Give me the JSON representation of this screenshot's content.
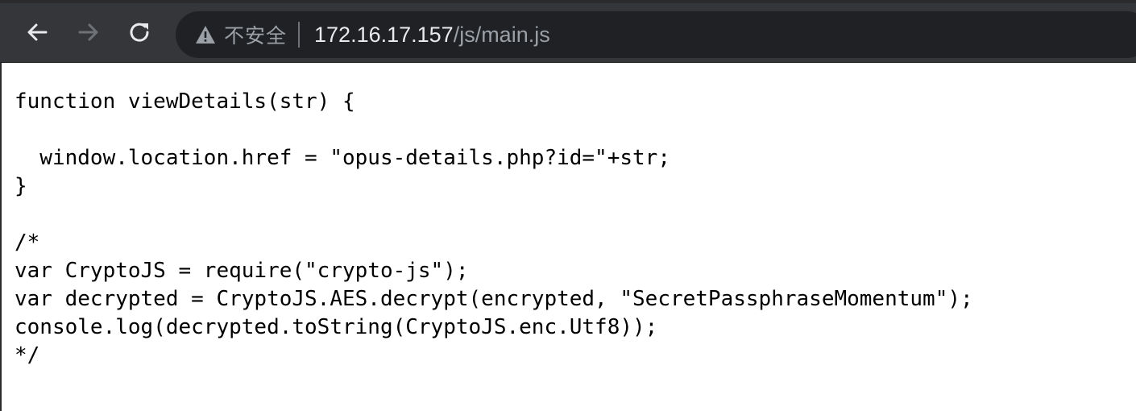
{
  "browser": {
    "nav": {
      "back_icon": "arrow-left-icon",
      "forward_icon": "arrow-right-icon",
      "reload_icon": "reload-icon"
    },
    "omnibox": {
      "security_icon": "warning-triangle-icon",
      "security_label": "不安全",
      "url_host": "172.16.17.157",
      "url_path": "/js/main.js"
    }
  },
  "page": {
    "source_lines": [
      "function viewDetails(str) {",
      "",
      "  window.location.href = \"opus-details.php?id=\"+str;",
      "}",
      "",
      "/*",
      "var CryptoJS = require(\"crypto-js\");",
      "var decrypted = CryptoJS.AES.decrypt(encrypted, \"SecretPassphraseMomentum\");",
      "console.log(decrypted.toString(CryptoJS.enc.Utf8));",
      "*/"
    ]
  },
  "colors": {
    "toolbar_bg": "#35363a",
    "omnibox_bg": "#202124",
    "url_host": "#e8eaed",
    "url_path": "#9aa0a6",
    "icon": "#e8eaed",
    "icon_disabled": "#6f7377"
  }
}
